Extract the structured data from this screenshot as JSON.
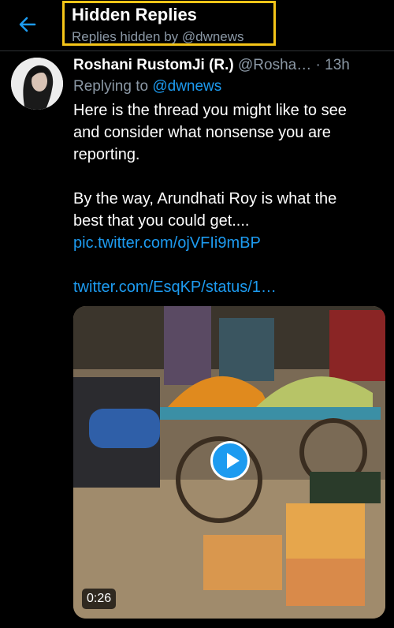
{
  "header": {
    "back_icon": "arrow-left-icon",
    "title": "Hidden Replies",
    "subtitle": "Replies hidden by @dwnews",
    "highlight_color": "#f5c518"
  },
  "tweet": {
    "author_name": "Roshani RustomJi (R.)",
    "author_handle": "@Rosha…",
    "time": "· 13h",
    "replying_prefix": "Replying to ",
    "replying_handle": "@dwnews",
    "lines": [
      "Here is the thread you might like to see",
      "and consider what nonsense you are",
      "reporting.",
      "By the way, Arundhati Roy is what the",
      "best that you could get...."
    ],
    "link1": "pic.twitter.com/ojVFIi9mBP",
    "link2": "twitter.com/EsqKP/status/1…"
  },
  "media": {
    "play_icon": "play-icon",
    "duration": "0:26"
  },
  "colors": {
    "link": "#1d9bf0",
    "background": "#000000"
  }
}
